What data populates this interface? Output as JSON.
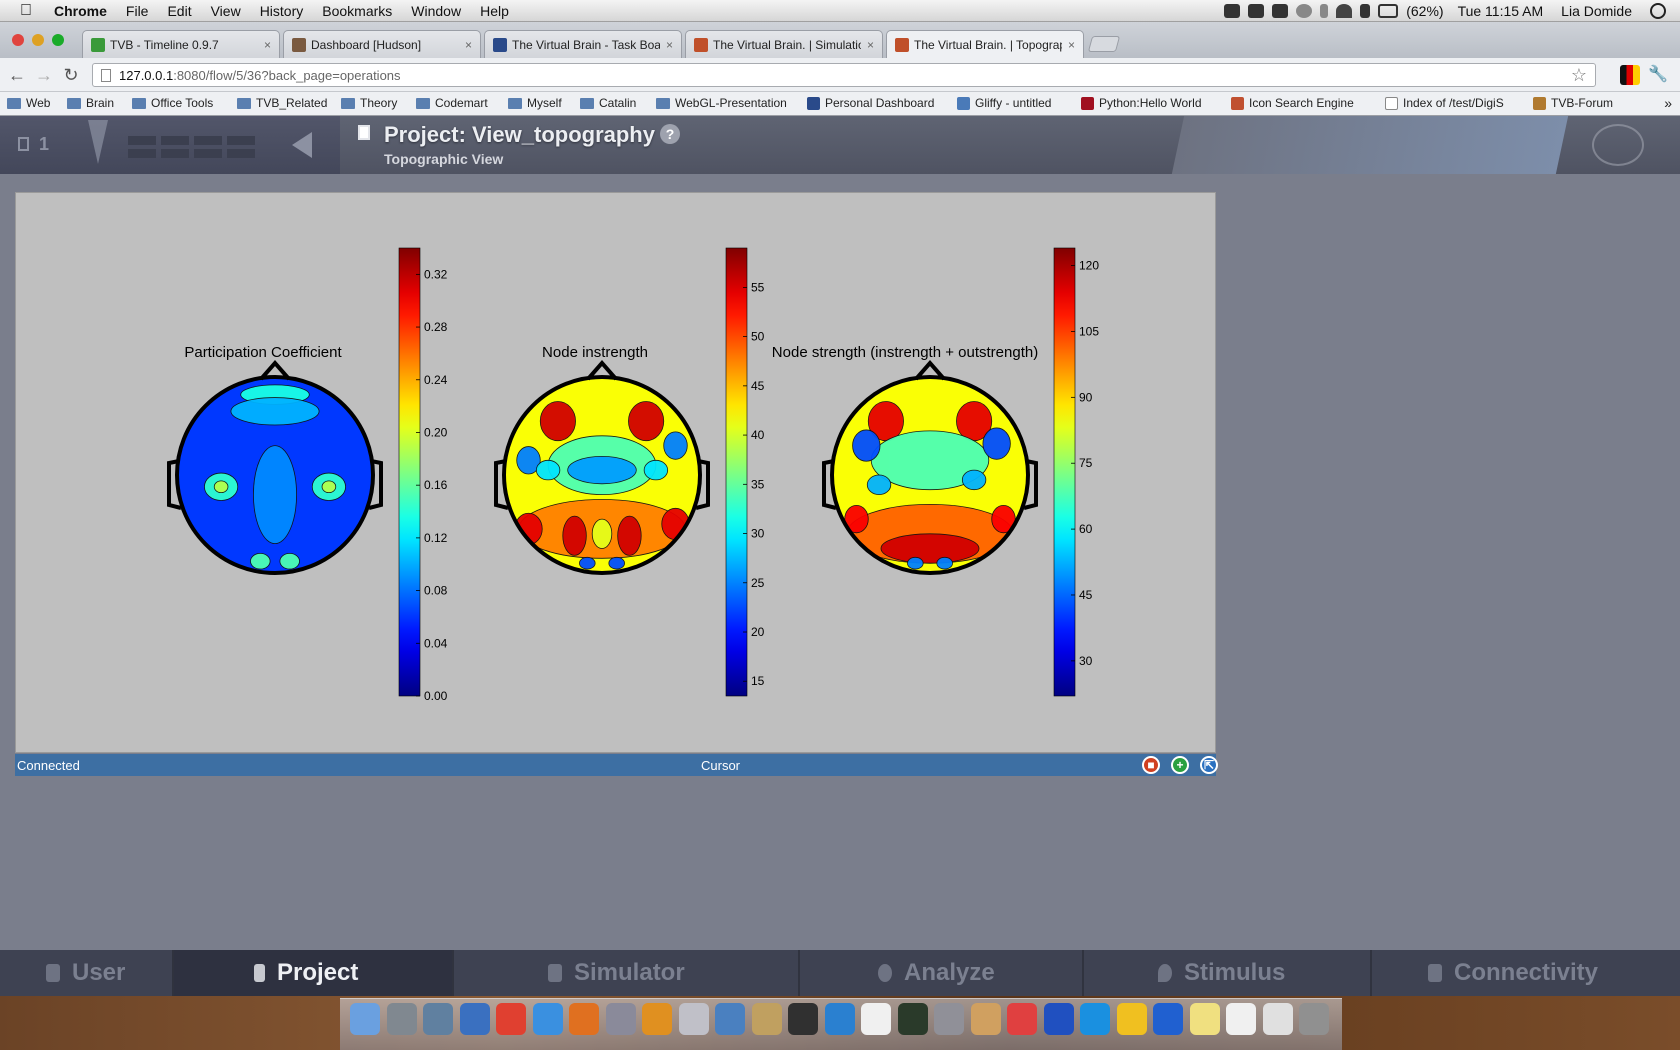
{
  "menubar": {
    "app": "Chrome",
    "items": [
      "File",
      "Edit",
      "View",
      "History",
      "Bookmarks",
      "Window",
      "Help"
    ],
    "battery": "(62%)",
    "clock": "Tue 11:15 AM",
    "user": "Lia Domide"
  },
  "tabs": [
    {
      "label": "TVB - Timeline 0.9.7",
      "close": "×",
      "icon_color": "#3a9a3a"
    },
    {
      "label": "Dashboard [Hudson]",
      "close": "×",
      "icon_color": "#7a5a40"
    },
    {
      "label": "The Virtual Brain - Task Boar",
      "close": "×",
      "icon_color": "#2a4a8a"
    },
    {
      "label": "The Virtual Brain. | Simulatio",
      "close": "×",
      "icon_color": "#c0502a"
    },
    {
      "label": "The Virtual Brain. | Topograp",
      "close": "×",
      "icon_color": "#c0502a"
    }
  ],
  "omnibox": {
    "host": "127.0.0.1",
    "path": ":8080/flow/5/36?back_page=operations"
  },
  "bookmarks": [
    {
      "label": "Web",
      "type": "folder"
    },
    {
      "label": "Brain",
      "type": "folder"
    },
    {
      "label": "Office Tools",
      "type": "folder"
    },
    {
      "label": "TVB_Related",
      "type": "folder"
    },
    {
      "label": "Theory",
      "type": "folder"
    },
    {
      "label": "Codemart",
      "type": "folder"
    },
    {
      "label": "Myself",
      "type": "folder"
    },
    {
      "label": "Catalin",
      "type": "folder"
    },
    {
      "label": "WebGL-Presentation",
      "type": "folder"
    },
    {
      "label": "Personal Dashboard",
      "type": "link"
    },
    {
      "label": "Gliffy - untitled",
      "type": "link"
    },
    {
      "label": "Python:Hello World",
      "type": "link"
    },
    {
      "label": "Icon Search Engine",
      "type": "link"
    },
    {
      "label": "Index of /test/DigiS",
      "type": "link"
    },
    {
      "label": "TVB-Forum",
      "type": "link"
    }
  ],
  "header": {
    "project_number": "1",
    "title": "Project: View_topography",
    "subtitle": "Topographic View",
    "help": "?"
  },
  "status": {
    "connected": "Connected",
    "cursor": "Cursor"
  },
  "bottom_nav": [
    "User",
    "Project",
    "Simulator",
    "Analyze",
    "Stimulus",
    "Connectivity"
  ],
  "chart_data": [
    {
      "type": "heatmap",
      "title": "Participation Coefficient",
      "colorbar_ticks": [
        "0.00",
        "0.04",
        "0.08",
        "0.12",
        "0.16",
        "0.20",
        "0.24",
        "0.28",
        "0.32"
      ],
      "colorbar_range": [
        0.0,
        0.34
      ]
    },
    {
      "type": "heatmap",
      "title": "Node instrength",
      "colorbar_ticks": [
        "15",
        "20",
        "25",
        "30",
        "35",
        "40",
        "45",
        "50",
        "55"
      ],
      "colorbar_range": [
        13.5,
        59
      ]
    },
    {
      "type": "heatmap",
      "title": "Node strength (instrength + outstrength)",
      "colorbar_ticks": [
        "30",
        "45",
        "60",
        "75",
        "90",
        "105",
        "120"
      ],
      "colorbar_range": [
        22,
        124
      ]
    }
  ]
}
